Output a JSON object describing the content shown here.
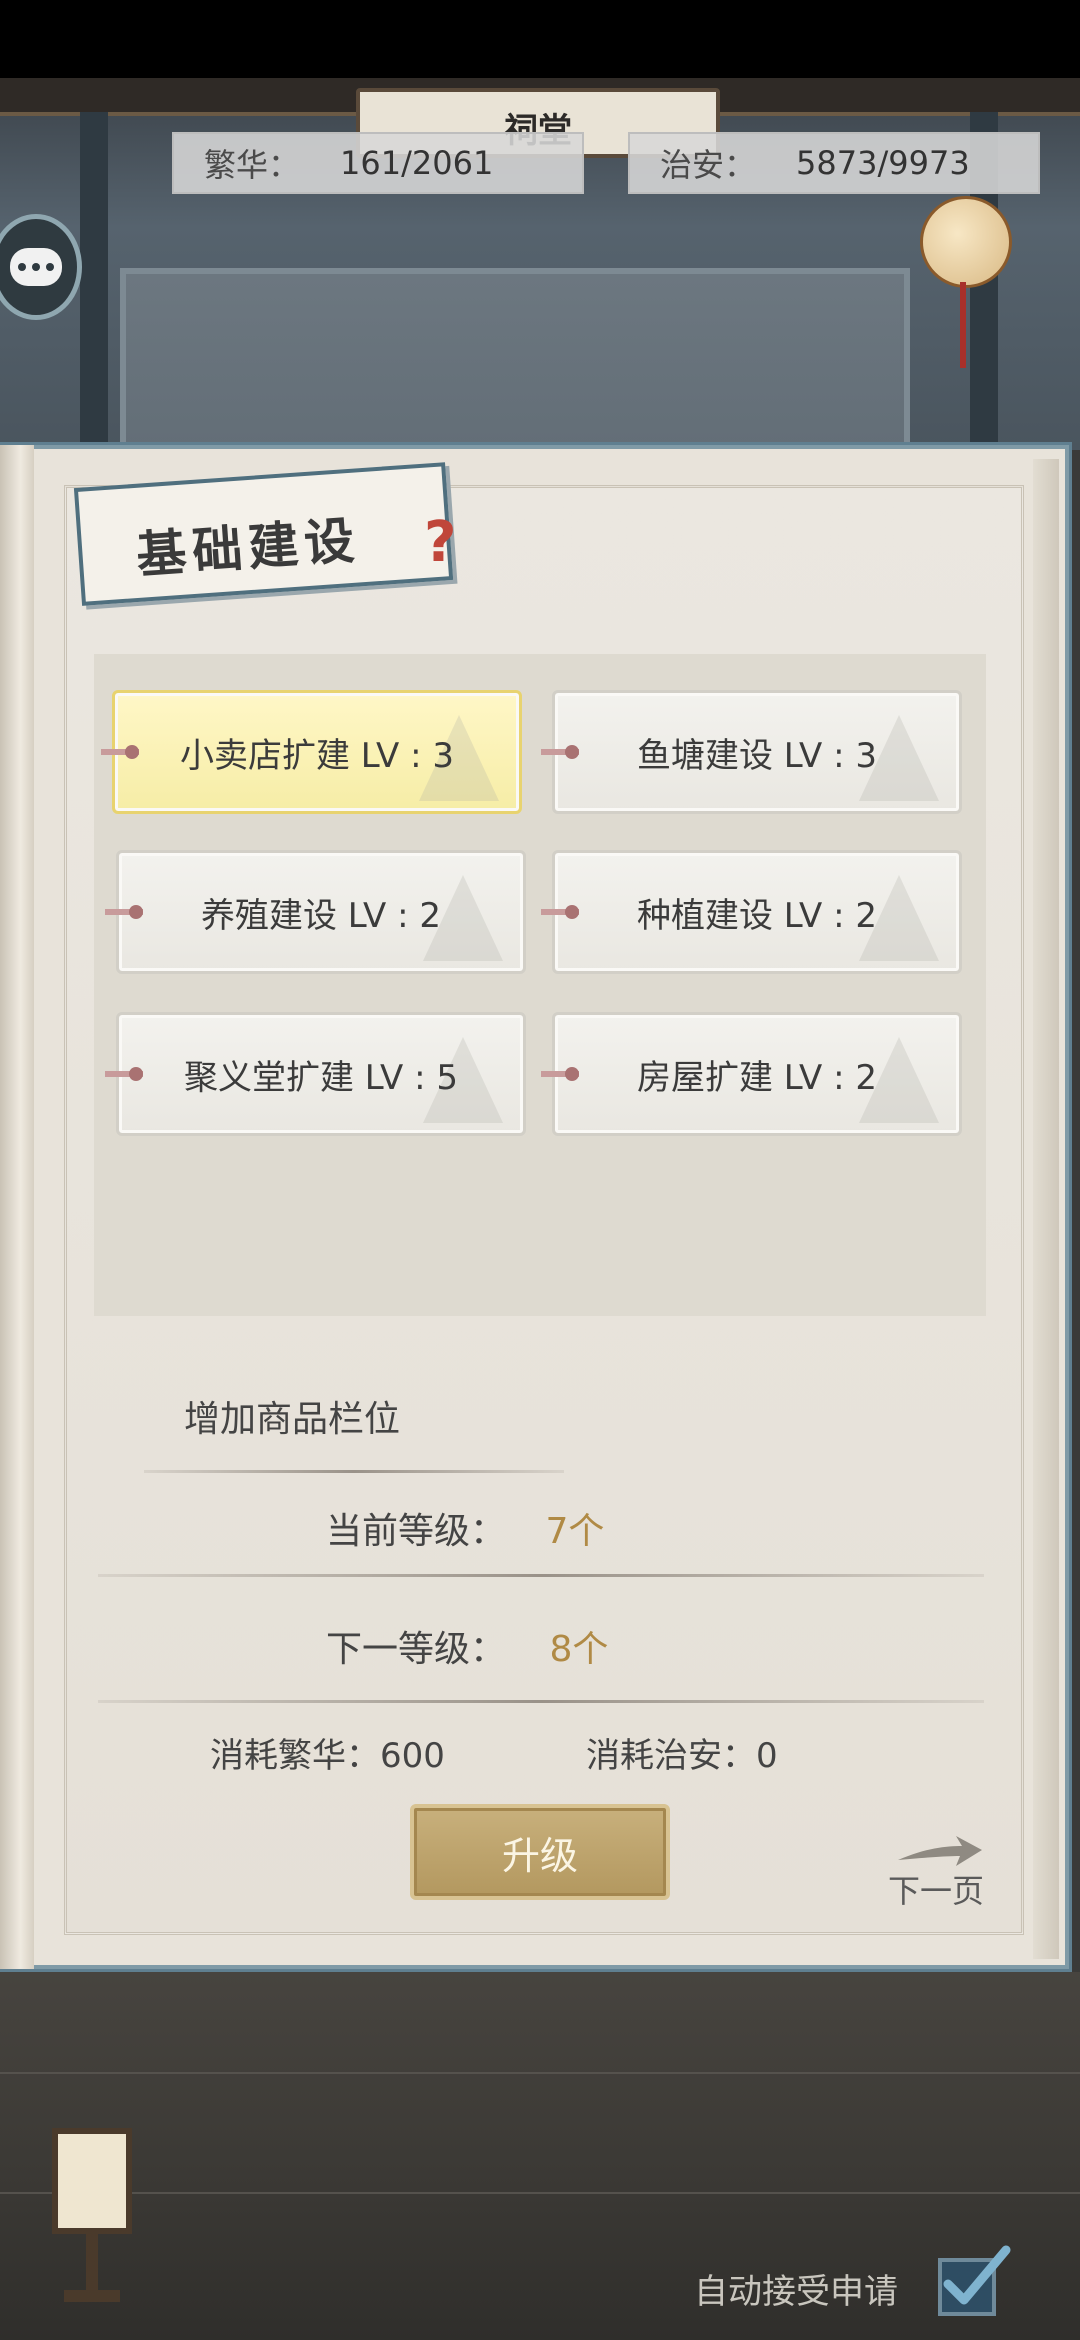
{
  "scene": {
    "hall_name": "祠堂"
  },
  "stats": {
    "prosperity": {
      "label": "繁华：",
      "value": "161/2061"
    },
    "security": {
      "label": "治安：",
      "value": "5873/9973"
    }
  },
  "panel": {
    "title": "基础建设",
    "help_icon": "question-icon",
    "buildings": [
      {
        "label": "小卖店扩建 LV : 3",
        "selected": true
      },
      {
        "label": "鱼塘建设 LV : 3",
        "selected": false
      },
      {
        "label": "养殖建设 LV : 2",
        "selected": false
      },
      {
        "label": "种植建设 LV : 2",
        "selected": false
      },
      {
        "label": "聚义堂扩建 LV : 5",
        "selected": false
      },
      {
        "label": "房屋扩建 LV : 2",
        "selected": false
      }
    ],
    "detail": {
      "description": "增加商品栏位",
      "current_level_label": "当前等级：",
      "current_level_value": "7个",
      "next_level_label": "下一等级：",
      "next_level_value": "8个",
      "cost_prosperity": "消耗繁华：600",
      "cost_security": "消耗治安：0"
    },
    "upgrade_button": "升级",
    "next_page": "下一页"
  },
  "footer": {
    "auto_accept_label": "自动接受申请",
    "auto_accept_checked": true
  },
  "colors": {
    "accent_gold": "#b08a45",
    "frame_blue": "#5f7f90",
    "selected_card": "#f6eda6"
  }
}
